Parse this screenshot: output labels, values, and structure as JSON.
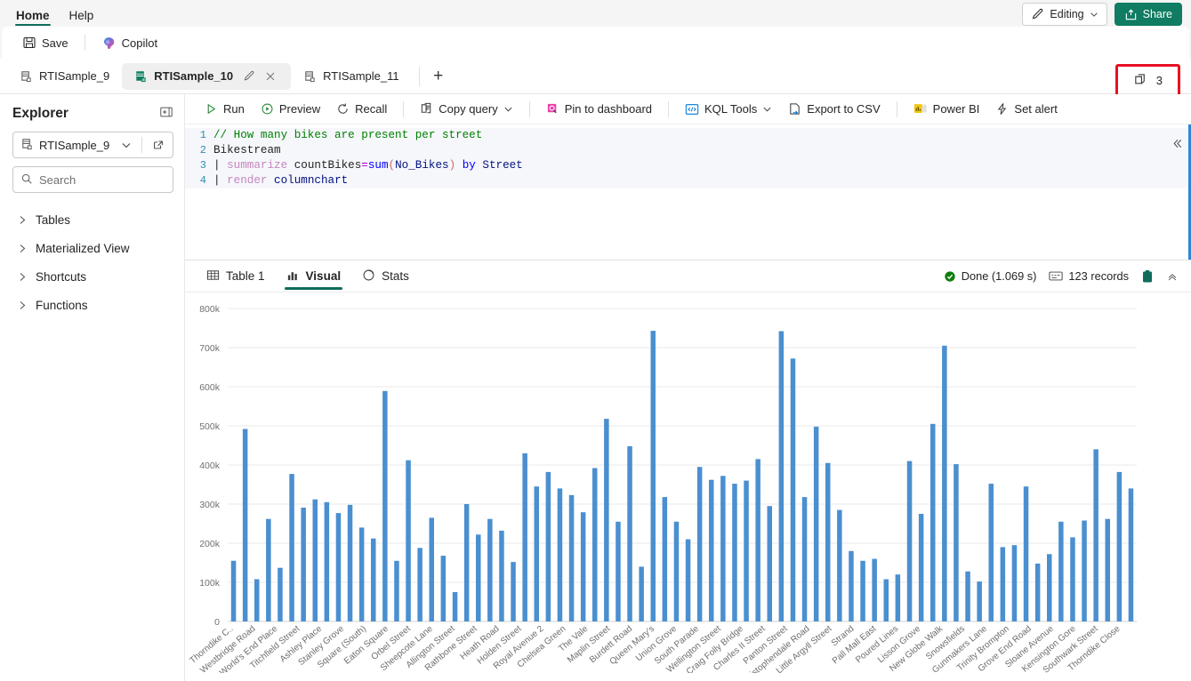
{
  "ribbon": {
    "tabs": [
      {
        "label": "Home",
        "active": true
      },
      {
        "label": "Help",
        "active": false
      }
    ],
    "editing_label": "Editing",
    "share_label": "Share"
  },
  "commandbar": {
    "save_label": "Save",
    "copilot_label": "Copilot"
  },
  "doctabs": {
    "tabs": [
      {
        "label": "RTISample_9",
        "active": false
      },
      {
        "label": "RTISample_10",
        "active": true
      },
      {
        "label": "RTISample_11",
        "active": false
      }
    ],
    "add_label": "+",
    "copy_count": "3",
    "highlight_color": "#e81123"
  },
  "explorer": {
    "title": "Explorer",
    "database_label": "RTISample_9",
    "search_placeholder": "Search",
    "search_value": "",
    "tree": [
      {
        "label": "Tables"
      },
      {
        "label": "Materialized View"
      },
      {
        "label": "Shortcuts"
      },
      {
        "label": "Functions"
      }
    ]
  },
  "query_toolbar": {
    "items": [
      {
        "label": "Run",
        "icon": "play-icon"
      },
      {
        "label": "Preview",
        "icon": "preview-icon"
      },
      {
        "label": "Recall",
        "icon": "recall-icon"
      },
      {
        "label": "Copy query",
        "icon": "copy-icon",
        "caret": true
      },
      {
        "label": "Pin to dashboard",
        "icon": "pin-icon"
      },
      {
        "label": "KQL Tools",
        "icon": "kql-icon",
        "caret": true
      },
      {
        "label": "Export to CSV",
        "icon": "export-icon"
      },
      {
        "label": "Power BI",
        "icon": "powerbi-icon"
      },
      {
        "label": "Set alert",
        "icon": "alert-icon"
      }
    ]
  },
  "editor": {
    "lines": [
      {
        "num": "1",
        "text": "// How many bikes are present per street"
      },
      {
        "num": "2",
        "text": "Bikestream"
      },
      {
        "num": "3",
        "text": "| summarize countBikes=sum(No_Bikes) by Street"
      },
      {
        "num": "4",
        "text": "| render columnchart"
      }
    ]
  },
  "results": {
    "tabs": [
      {
        "label": "Table 1",
        "icon": "table-icon",
        "active": false
      },
      {
        "label": "Visual",
        "icon": "chart-icon",
        "active": true
      },
      {
        "label": "Stats",
        "icon": "stats-icon",
        "active": false
      }
    ],
    "status_text": "Done (1.069 s)",
    "records_text": "123 records",
    "status_color": "#107c10"
  },
  "chart_data": {
    "type": "bar",
    "title": "",
    "xlabel": "",
    "ylabel": "",
    "ylim": [
      0,
      800000
    ],
    "ytick_labels": [
      "0",
      "100k",
      "200k",
      "300k",
      "400k",
      "500k",
      "600k",
      "700k",
      "800k"
    ],
    "ytick_values": [
      0,
      100000,
      200000,
      300000,
      400000,
      500000,
      600000,
      700000,
      800000
    ],
    "grid": true,
    "legend": "none",
    "bar_color": "#4a8fd0",
    "series_name": "countBikes",
    "categories": [
      "Thorndike C..",
      "Westbridge Road",
      "World's End Place",
      "Titchfield Street",
      "Ashley Place",
      "Stanley Grove",
      "Square (South)",
      "Eaton Square",
      "Orbel Street",
      "Sheepcote Lane",
      "Allington Street",
      "Rathbone Street",
      "Heath Road",
      "Holden Street",
      "Royal Avenue 2",
      "Chelsea Green",
      "The Vale",
      "Maplin Street",
      "Burdett Road",
      "Queen Mary's",
      "Union Grove",
      "South Parade",
      "Wellington Street",
      "Craig Folly Bridge",
      "Charles II Street",
      "Panton Street",
      "Christophendale Road",
      "Little Argyll Street",
      "Strand",
      "Pall Mall East",
      "Poured Lines",
      "Lisson Grove",
      "New Globe Walk",
      "Snowsfields",
      "Gunmakers Lane",
      "Trinity Brompton",
      "Grove End Road",
      "Sloane Avenue",
      "Kensington Gore",
      "Southwark Street",
      "Thorndike Close"
    ],
    "values": [
      155000,
      492000,
      108000,
      262000,
      137000,
      377000,
      291000,
      312000,
      305000,
      277000,
      298000,
      240000,
      212000,
      589000,
      155000,
      412000,
      188000,
      265000,
      168000,
      75000,
      300000,
      222000,
      262000,
      232000,
      152000,
      430000,
      345000,
      382000,
      340000,
      323000,
      279000,
      392000,
      518000,
      255000,
      448000,
      140000,
      743000,
      318000,
      255000,
      210000,
      395000,
      362000,
      372000,
      352000,
      360000,
      415000,
      295000,
      742000,
      672000,
      318000,
      498000,
      405000,
      285000,
      180000,
      155000,
      160000,
      108000,
      120000,
      410000,
      275000,
      505000,
      705000,
      402000,
      128000,
      102000,
      352000,
      190000,
      195000,
      345000,
      148000,
      172000,
      255000,
      215000,
      258000,
      440000,
      262000,
      382000,
      340000
    ]
  }
}
